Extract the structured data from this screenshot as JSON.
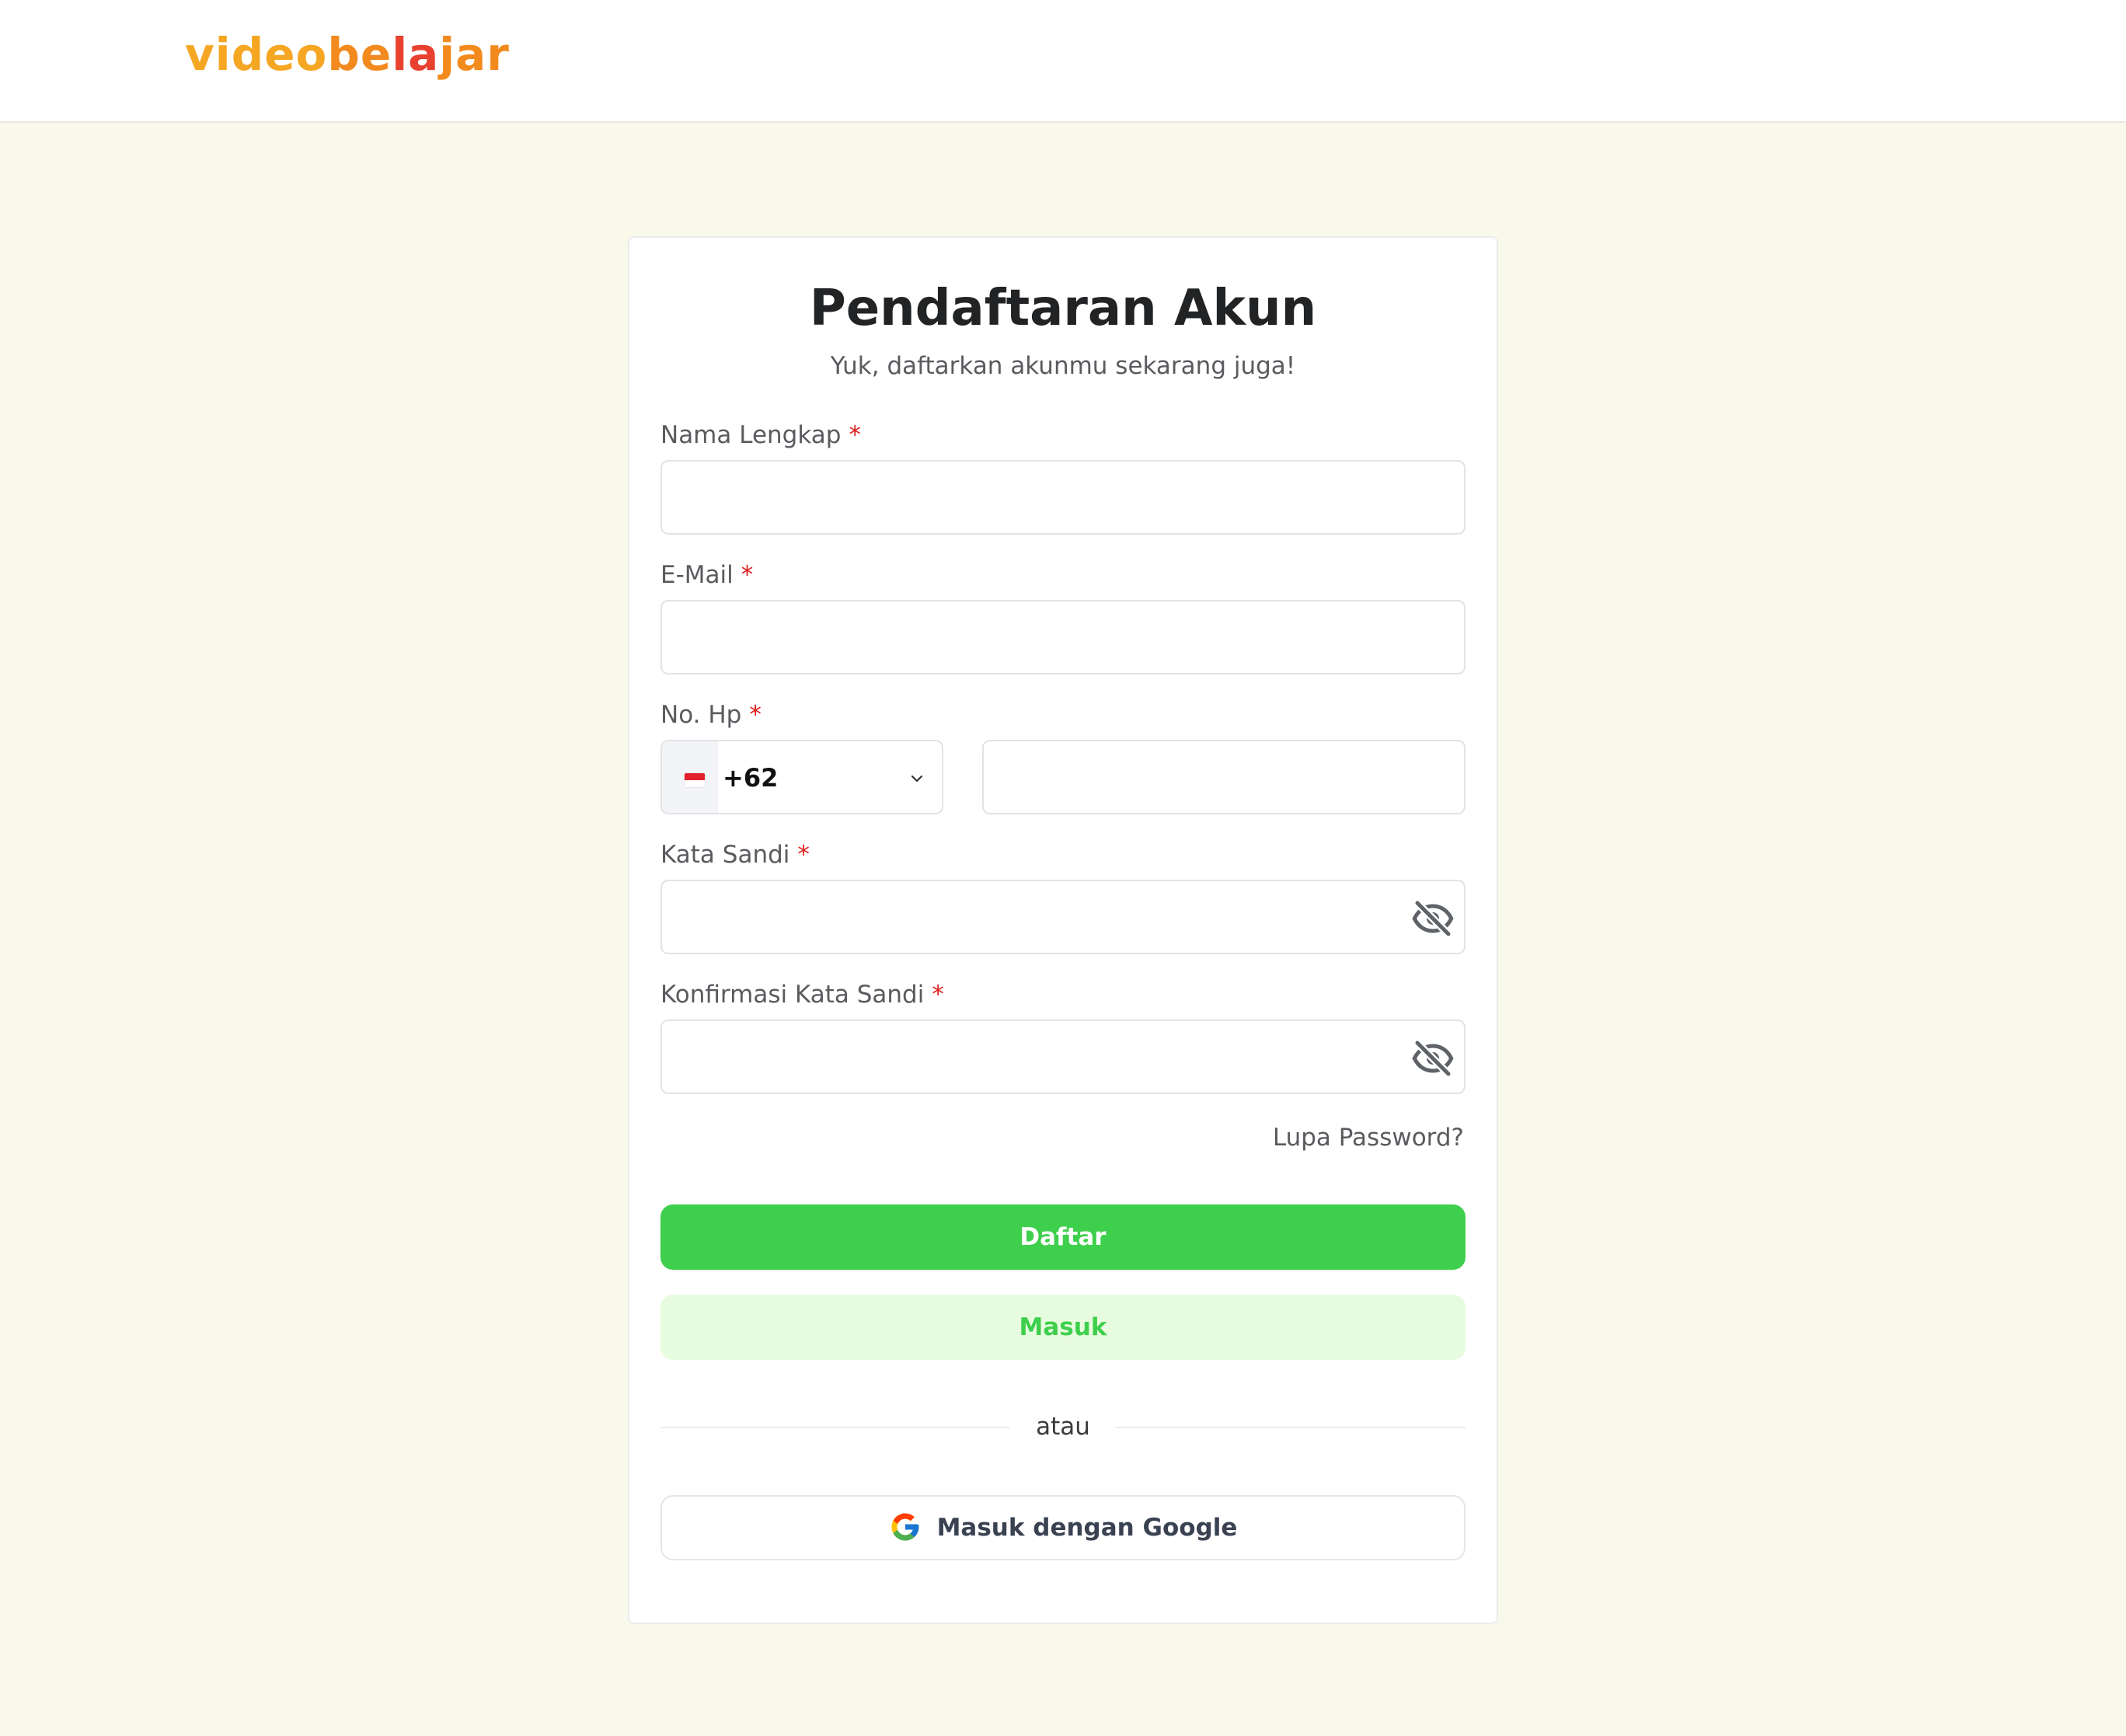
{
  "header": {
    "logo_parts": [
      "video",
      "be",
      "la",
      "jar"
    ]
  },
  "form": {
    "title": "Pendaftaran Akun",
    "subtitle": "Yuk, daftarkan akunmu sekarang juga!",
    "required_mark": "*",
    "fields": {
      "full_name": {
        "label": "Nama Lengkap",
        "value": ""
      },
      "email": {
        "label": "E-Mail",
        "value": ""
      },
      "phone": {
        "label": "No. Hp",
        "country_code": "+62",
        "country_flag": "indonesia-flag-icon",
        "value": ""
      },
      "password": {
        "label": "Kata Sandi",
        "value": ""
      },
      "confirm_password": {
        "label": "Konfirmasi Kata Sandi",
        "value": ""
      }
    },
    "forgot_password": "Lupa Password?",
    "register_button": "Daftar",
    "login_button": "Masuk",
    "divider_text": "atau",
    "google_button": "Masuk dengan Google"
  },
  "colors": {
    "primary": "#3ecf4c",
    "primary_soft": "#e7fbde",
    "page_background": "#f9f9eb",
    "required": "#e11d1d"
  }
}
